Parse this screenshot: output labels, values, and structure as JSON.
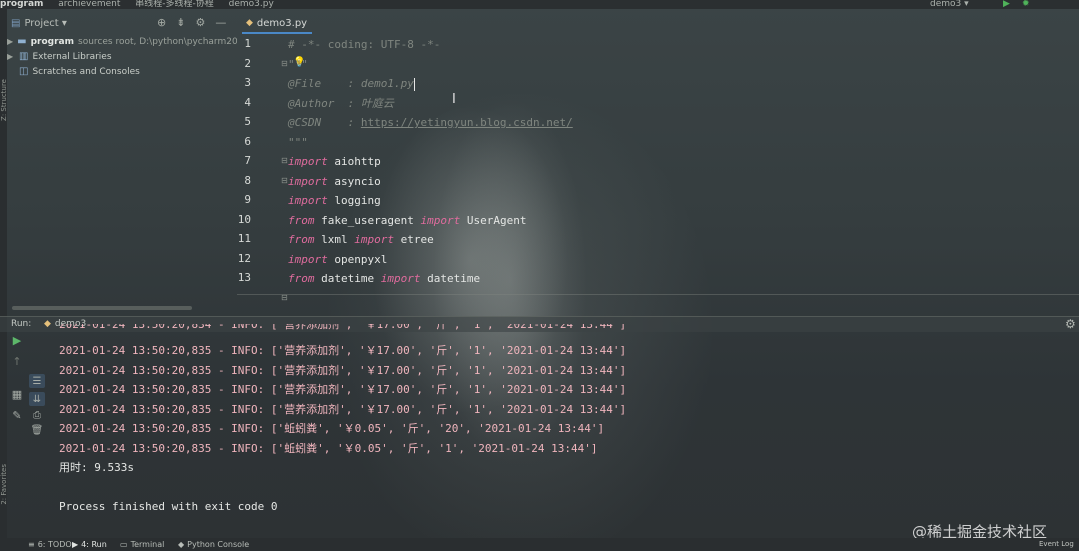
{
  "topbar": {
    "crumbs": [
      "program",
      "archievement",
      "串线程-多线程-协程",
      "demo3.py"
    ],
    "run_config": "demo3 ▾",
    "run_icon": "run-icon",
    "debug_icon": "debug-icon"
  },
  "leftstrip": {
    "structure_label": "Z: Structure",
    "favorites_label": "2: Favorites"
  },
  "project": {
    "title": "Project ▾",
    "tree": [
      {
        "arrow": "▶",
        "name": "program",
        "extra": "sources root, D:\\python\\pycharm202"
      },
      {
        "arrow": "▶",
        "name": "External Libraries",
        "extra": ""
      },
      {
        "arrow": "",
        "name": "Scratches and Consoles",
        "extra": ""
      }
    ]
  },
  "editor": {
    "tab_label": "demo3.py",
    "line_numbers": [
      "1",
      "2",
      "3",
      "4",
      "5",
      "6",
      "7",
      "8",
      "9",
      "10",
      "11",
      "12",
      "13"
    ],
    "lines": [
      [
        {
          "t": "# -*- coding: UTF-8 -*-",
          "c": "comment"
        }
      ],
      [
        {
          "t": "\"\"\"",
          "c": "doc"
        }
      ],
      [
        {
          "t": "@File    : demo1.py",
          "c": "doc"
        }
      ],
      [
        {
          "t": "@Author  : 叶庭云",
          "c": "doc"
        }
      ],
      [
        {
          "t": "@CSDN    : ",
          "c": "doc"
        },
        {
          "t": "https://yetingyun.blog.csdn.net/",
          "c": "link"
        }
      ],
      [
        {
          "t": "\"\"\"",
          "c": "doc"
        }
      ],
      [
        {
          "t": "import",
          "c": "kw"
        },
        {
          "t": " aiohttp",
          "c": "plain"
        }
      ],
      [
        {
          "t": "import",
          "c": "kw"
        },
        {
          "t": " asyncio",
          "c": "plain"
        }
      ],
      [
        {
          "t": "import",
          "c": "kw"
        },
        {
          "t": " logging",
          "c": "plain"
        }
      ],
      [
        {
          "t": "from",
          "c": "kw"
        },
        {
          "t": " fake_useragent ",
          "c": "plain"
        },
        {
          "t": "import",
          "c": "kw"
        },
        {
          "t": " UserAgent",
          "c": "plain"
        }
      ],
      [
        {
          "t": "from",
          "c": "kw"
        },
        {
          "t": " lxml ",
          "c": "plain"
        },
        {
          "t": "import",
          "c": "kw"
        },
        {
          "t": " etree",
          "c": "plain"
        }
      ],
      [
        {
          "t": "import",
          "c": "kw"
        },
        {
          "t": " openpyxl",
          "c": "plain"
        }
      ],
      [
        {
          "t": "from",
          "c": "kw"
        },
        {
          "t": " datetime ",
          "c": "plain"
        },
        {
          "t": "import",
          "c": "kw"
        },
        {
          "t": " datetime",
          "c": "plain"
        }
      ]
    ]
  },
  "run": {
    "label": "Run:",
    "tab_label": "demo3",
    "log_lines": [
      "2021-01-24 13:50:20,834 - INFO: ['营养添加剂', '￥17.00', '斤', '1', '2021-01-24 13:44']",
      "2021-01-24 13:50:20,835 - INFO: ['营养添加剂', '￥17.00', '斤', '1', '2021-01-24 13:44']",
      "2021-01-24 13:50:20,835 - INFO: ['营养添加剂', '￥17.00', '斤', '1', '2021-01-24 13:44']",
      "2021-01-24 13:50:20,835 - INFO: ['营养添加剂', '￥17.00', '斤', '1', '2021-01-24 13:44']",
      "2021-01-24 13:50:20,835 - INFO: ['营养添加剂', '￥17.00', '斤', '1', '2021-01-24 13:44']",
      "2021-01-24 13:50:20,835 - INFO: ['蚯蚓粪', '￥0.05', '斤', '20', '2021-01-24 13:44']",
      "2021-01-24 13:50:20,835 - INFO: ['蚯蚓粪', '￥0.05', '斤', '1', '2021-01-24 13:44']"
    ],
    "elapsed": "用时: 9.533s",
    "finished": "Process finished with exit code 0"
  },
  "statusbar": {
    "todo": "6: TODO",
    "run": "4: Run",
    "terminal": "Terminal",
    "python_console": "Python Console",
    "event_log": "Event Log"
  },
  "watermark": "@稀土掘金技术社区"
}
